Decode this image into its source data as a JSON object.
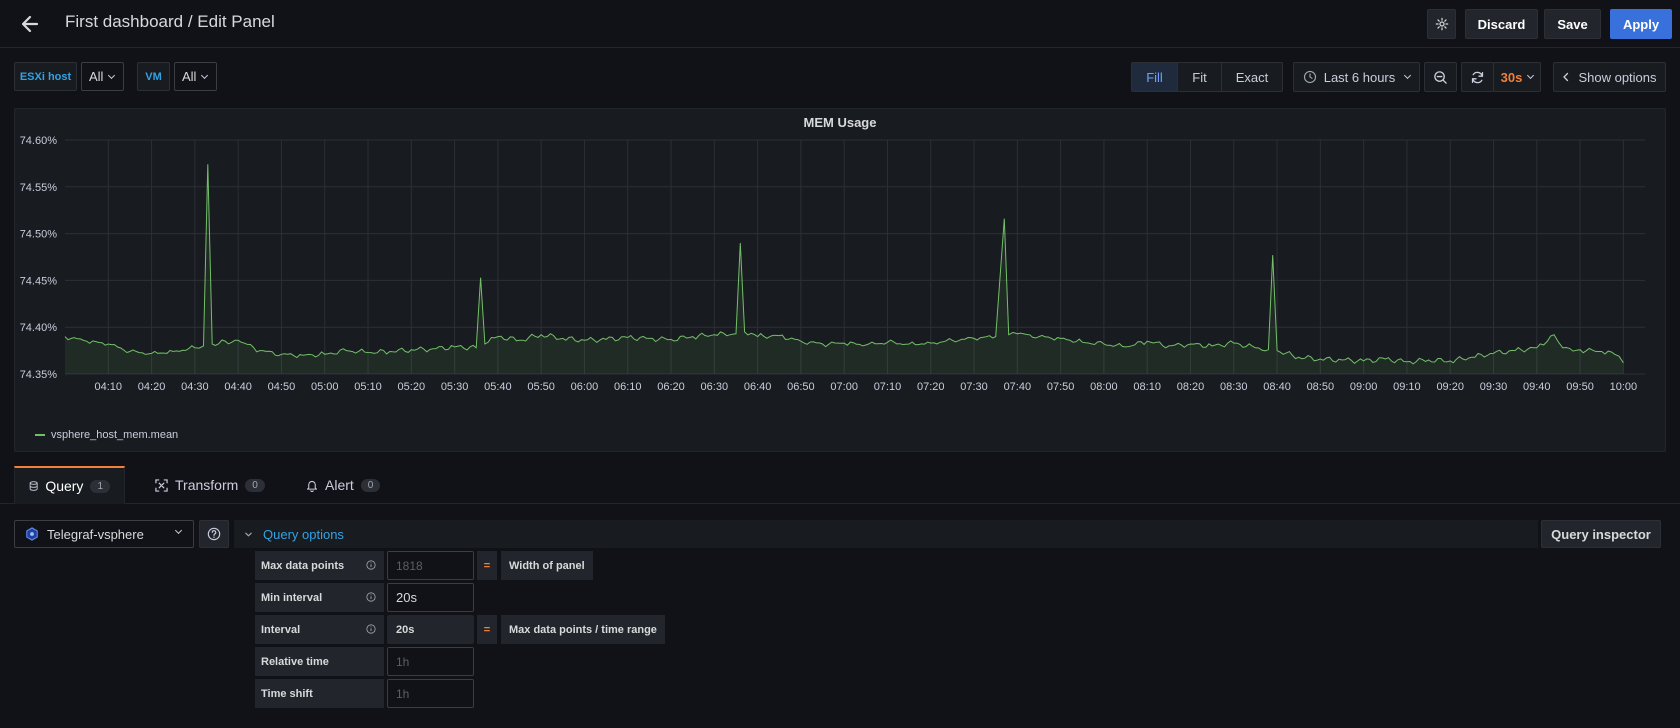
{
  "header": {
    "title": "First dashboard / Edit Panel",
    "discard_label": "Discard",
    "save_label": "Save",
    "apply_label": "Apply"
  },
  "variables": [
    {
      "label": "ESXi host",
      "value": "All"
    },
    {
      "label": "VM",
      "value": "All"
    }
  ],
  "controls": {
    "fit_modes": [
      "Fill",
      "Fit",
      "Exact"
    ],
    "active_fit_mode": "Fill",
    "time_range": "Last 6 hours",
    "refresh_interval": "30s",
    "show_options_label": "Show options"
  },
  "panel": {
    "title": "MEM Usage",
    "legend_series": "vsphere_host_mem.mean"
  },
  "chart_data": {
    "type": "line",
    "title": "MEM Usage",
    "ylim": [
      74.35,
      74.6
    ],
    "y_ticks": [
      "74.60%",
      "74.55%",
      "74.50%",
      "74.45%",
      "74.40%",
      "74.35%"
    ],
    "x_ticks": [
      "04:10",
      "04:20",
      "04:30",
      "04:40",
      "04:50",
      "05:00",
      "05:10",
      "05:20",
      "05:30",
      "05:40",
      "05:50",
      "06:00",
      "06:10",
      "06:20",
      "06:30",
      "06:40",
      "06:50",
      "07:00",
      "07:10",
      "07:20",
      "07:30",
      "07:40",
      "07:50",
      "08:00",
      "08:10",
      "08:20",
      "08:30",
      "08:40",
      "08:50",
      "09:00",
      "09:10",
      "09:20",
      "09:30",
      "09:40",
      "09:50",
      "10:00"
    ],
    "series": [
      {
        "name": "vsphere_host_mem.mean",
        "color": "#73bf69",
        "points": [
          [
            "04:00",
            74.39
          ],
          [
            "04:05",
            74.385
          ],
          [
            "04:10",
            74.382
          ],
          [
            "04:15",
            74.374
          ],
          [
            "04:20",
            74.372
          ],
          [
            "04:25",
            74.374
          ],
          [
            "04:30",
            74.378
          ],
          [
            "04:32",
            74.38
          ],
          [
            "04:33",
            74.574
          ],
          [
            "04:34",
            74.382
          ],
          [
            "04:40",
            74.386
          ],
          [
            "04:45",
            74.375
          ],
          [
            "04:50",
            74.371
          ],
          [
            "04:55",
            74.37
          ],
          [
            "05:00",
            74.371
          ],
          [
            "05:05",
            74.375
          ],
          [
            "05:10",
            74.373
          ],
          [
            "05:15",
            74.374
          ],
          [
            "05:20",
            74.376
          ],
          [
            "05:25",
            74.377
          ],
          [
            "05:30",
            74.379
          ],
          [
            "05:35",
            74.378
          ],
          [
            "05:36",
            74.453
          ],
          [
            "05:37",
            74.382
          ],
          [
            "05:40",
            74.39
          ],
          [
            "05:45",
            74.386
          ],
          [
            "05:50",
            74.392
          ],
          [
            "05:55",
            74.388
          ],
          [
            "06:00",
            74.386
          ],
          [
            "06:05",
            74.387
          ],
          [
            "06:10",
            74.389
          ],
          [
            "06:15",
            74.388
          ],
          [
            "06:20",
            74.387
          ],
          [
            "06:25",
            74.39
          ],
          [
            "06:30",
            74.392
          ],
          [
            "06:35",
            74.393
          ],
          [
            "06:36",
            74.49
          ],
          [
            "06:37",
            74.395
          ],
          [
            "06:40",
            74.39
          ],
          [
            "06:45",
            74.391
          ],
          [
            "06:50",
            74.385
          ],
          [
            "06:55",
            74.382
          ],
          [
            "07:00",
            74.383
          ],
          [
            "07:05",
            74.381
          ],
          [
            "07:10",
            74.384
          ],
          [
            "07:15",
            74.382
          ],
          [
            "07:20",
            74.383
          ],
          [
            "07:25",
            74.386
          ],
          [
            "07:30",
            74.388
          ],
          [
            "07:35",
            74.39
          ],
          [
            "07:37",
            74.516
          ],
          [
            "07:38",
            74.392
          ],
          [
            "07:40",
            74.393
          ],
          [
            "07:45",
            74.39
          ],
          [
            "07:50",
            74.388
          ],
          [
            "07:55",
            74.384
          ],
          [
            "08:00",
            74.382
          ],
          [
            "08:05",
            74.379
          ],
          [
            "08:10",
            74.385
          ],
          [
            "08:15",
            74.38
          ],
          [
            "08:20",
            74.382
          ],
          [
            "08:25",
            74.38
          ],
          [
            "08:30",
            74.383
          ],
          [
            "08:35",
            74.378
          ],
          [
            "08:38",
            74.376
          ],
          [
            "08:39",
            74.477
          ],
          [
            "08:40",
            74.375
          ],
          [
            "08:45",
            74.368
          ],
          [
            "08:50",
            74.366
          ],
          [
            "08:55",
            74.365
          ],
          [
            "09:00",
            74.364
          ],
          [
            "09:05",
            74.366
          ],
          [
            "09:10",
            74.363
          ],
          [
            "09:15",
            74.365
          ],
          [
            "09:20",
            74.364
          ],
          [
            "09:25",
            74.368
          ],
          [
            "09:30",
            74.372
          ],
          [
            "09:35",
            74.375
          ],
          [
            "09:40",
            74.378
          ],
          [
            "09:44",
            74.392
          ],
          [
            "09:46",
            74.378
          ],
          [
            "09:50",
            74.376
          ],
          [
            "09:55",
            74.374
          ],
          [
            "09:58",
            74.371
          ],
          [
            "10:00",
            74.362
          ]
        ]
      }
    ]
  },
  "editor": {
    "tabs": [
      {
        "label": "Query",
        "count": "1"
      },
      {
        "label": "Transform",
        "count": "0"
      },
      {
        "label": "Alert",
        "count": "0"
      }
    ],
    "datasource": "Telegraf-vsphere",
    "query_options_label": "Query options",
    "query_inspector_label": "Query inspector",
    "options": {
      "max_data_points": {
        "label": "Max data points",
        "placeholder": "1818",
        "hint": "Width of panel"
      },
      "min_interval": {
        "label": "Min interval",
        "value": "20s"
      },
      "interval": {
        "label": "Interval",
        "value": "20s",
        "hint": "Max data points / time range"
      },
      "relative_time": {
        "label": "Relative time",
        "placeholder": "1h"
      },
      "time_shift": {
        "label": "Time shift",
        "placeholder": "1h"
      },
      "equals": "="
    }
  }
}
